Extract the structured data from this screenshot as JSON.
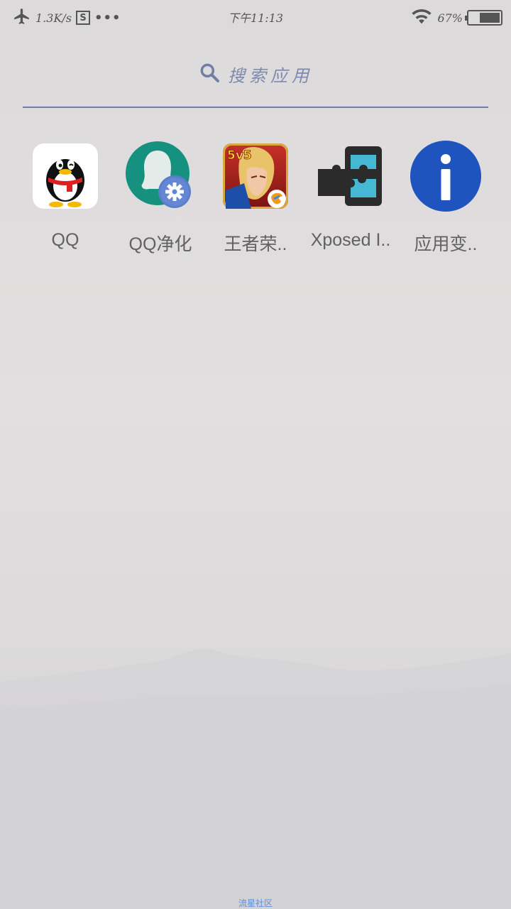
{
  "status_bar": {
    "network_speed": "1.3K/s",
    "sim_badge": "S",
    "more_dots": "•••",
    "time": "下午11:13",
    "battery_percent": "67%",
    "battery_level": 0.67,
    "icons": [
      "airplane-icon",
      "wifi-icon",
      "battery-icon"
    ]
  },
  "search": {
    "placeholder": "搜索应用",
    "icon": "search-icon",
    "accent_color": "#6f7ea6"
  },
  "apps": [
    {
      "label": "QQ",
      "icon": "qq-penguin-icon"
    },
    {
      "label": "QQ净化",
      "icon": "qq-purify-icon"
    },
    {
      "label": "王者荣..",
      "icon": "honor-of-kings-icon"
    },
    {
      "label": "Xposed I..",
      "icon": "xposed-installer-icon"
    },
    {
      "label": "应用变..",
      "icon": "info-icon"
    }
  ],
  "footer": {
    "watermark": "流星社区"
  }
}
